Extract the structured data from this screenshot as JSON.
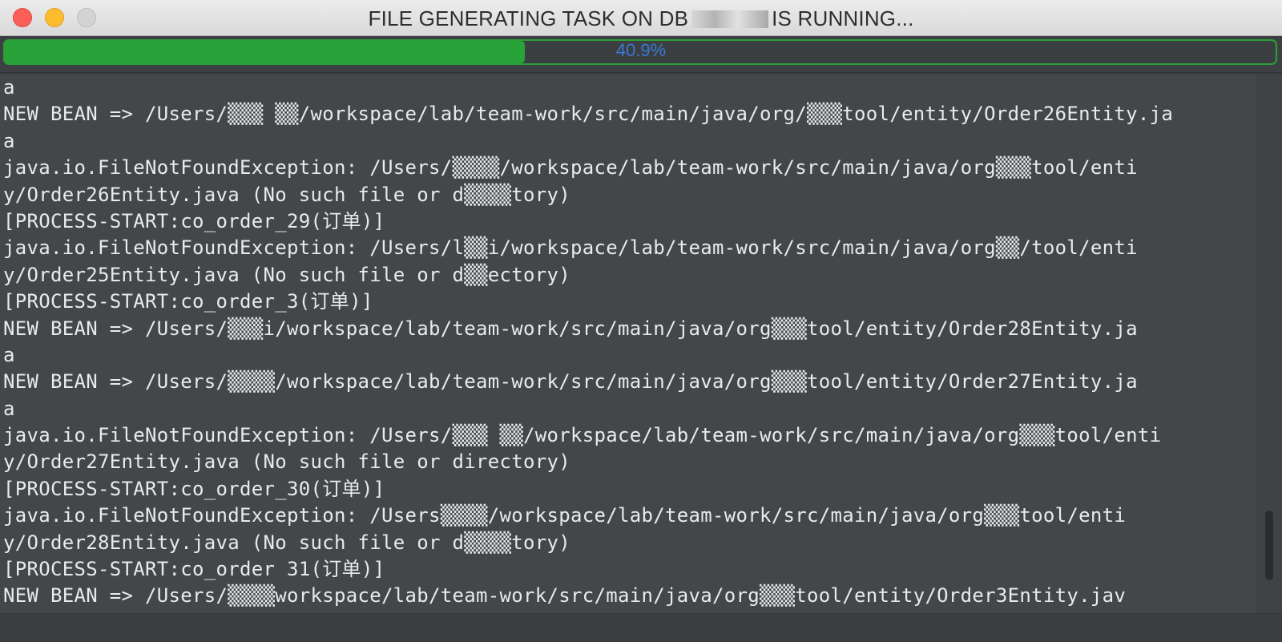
{
  "window": {
    "title": "FILE GENERATING TASK ON DB ▒▒▒▒ IS RUNNING...",
    "title_prefix": "FILE GENERATING TASK ON DB",
    "title_suffix": "IS RUNNING..."
  },
  "progress": {
    "percent": 40.9,
    "label": "40.9%",
    "fill_color": "#28a33a",
    "label_color": "#3a78d2"
  },
  "console": {
    "lines": [
      "a",
      "NEW BEAN => /Users/▒▒▒ ▒▒/workspace/lab/team-work/src/main/java/org/▒▒▒tool/entity/Order26Entity.ja",
      "a",
      "java.io.FileNotFoundException: /Users/▒▒▒▒/workspace/lab/team-work/src/main/java/org▒▒▒tool/enti",
      "y/Order26Entity.java (No such file or d▒▒▒▒tory)",
      "[PROCESS-START:co_order_29(订单)]",
      "java.io.FileNotFoundException: /Users/l▒▒i/workspace/lab/team-work/src/main/java/org▒▒/tool/enti",
      "y/Order25Entity.java (No such file or d▒▒ectory)",
      "[PROCESS-START:co_order_3(订单)]",
      "NEW BEAN => /Users/▒▒▒i/workspace/lab/team-work/src/main/java/org▒▒▒tool/entity/Order28Entity.ja",
      "a",
      "NEW BEAN => /Users/▒▒▒▒/workspace/lab/team-work/src/main/java/org▒▒▒tool/entity/Order27Entity.ja",
      "a",
      "java.io.FileNotFoundException: /Users/▒▒▒ ▒▒/workspace/lab/team-work/src/main/java/org▒▒▒tool/enti",
      "y/Order27Entity.java (No such file or directory)",
      "[PROCESS-START:co_order_30(订单)]",
      "java.io.FileNotFoundException: /Users▒▒▒▒/workspace/lab/team-work/src/main/java/org▒▒▒tool/enti",
      "y/Order28Entity.java (No such file or d▒▒▒▒tory)",
      "[PROCESS-START:co_order 31(订单)]",
      "NEW BEAN => /Users/▒▒▒▒workspace/lab/team-work/src/main/java/org▒▒▒tool/entity/Order3Entity.jav"
    ]
  },
  "scrollbar": {
    "position": 0.93,
    "visible_fraction": 0.13
  }
}
